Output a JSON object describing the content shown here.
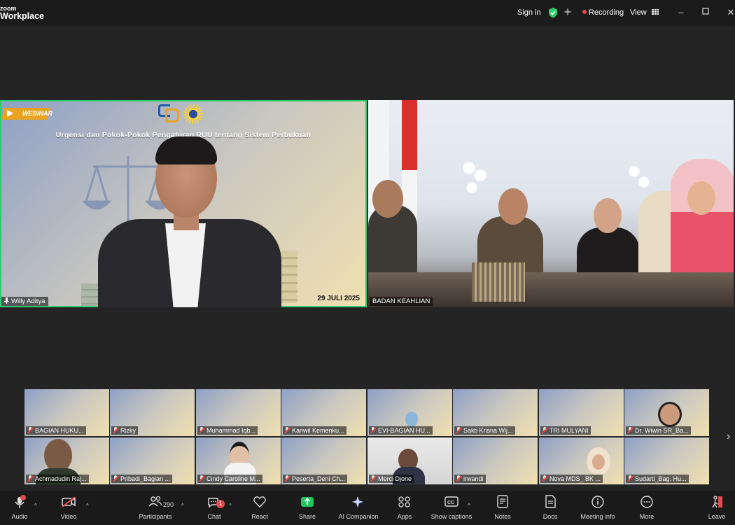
{
  "app": {
    "logo_line1": "zoom",
    "logo_line2": "Workplace"
  },
  "titlebar": {
    "sign_in": "Sign in",
    "recording": "Recording",
    "view": "View"
  },
  "main_tiles": [
    {
      "name": "Willy Aditya",
      "slide_tag": "WEBINAR",
      "slide_title": "Urgensi dan Pokok-Pokok Pengaturan RUU tentang Sistem Perbukuan",
      "slide_date": "29 JULI 2025"
    },
    {
      "name": "BADAN KEAHLIAN"
    }
  ],
  "participants_row1": [
    "BAGIAN HUKU...",
    "Rizky",
    "Muhammad Iqb...",
    "Kanwil Kemenku...",
    "EVI-BAGIAN HU...",
    "Sakti Krisna Wij...",
    "TRI MULYANI",
    "Dr. Wiwin SR_Ba..."
  ],
  "participants_row2": [
    "Achmadudin Raj...",
    "Pribadi_Bagian ...",
    "Cindy Caroline M...",
    "Peserta_Deni Ch...",
    "Merci Djone",
    "irwandi",
    "Nova MDS_ BK ...",
    "Sudarti_Bag. Hu..."
  ],
  "toolbar": {
    "audio": "Audio",
    "video": "Video",
    "participants": "Participants",
    "participants_count": "290",
    "chat": "Chat",
    "chat_badge": "1",
    "react": "React",
    "share": "Share",
    "ai_companion": "AI Companion",
    "apps": "Apps",
    "show_captions": "Show captions",
    "notes": "Notes",
    "docs": "Docs",
    "meeting_info": "Meeting info",
    "more": "More",
    "leave": "Leave"
  },
  "colors": {
    "active_speaker_border": "#2ecc71",
    "share_green": "#22c55e",
    "leave_red": "#e5484d",
    "recording_red": "#e5484d"
  }
}
